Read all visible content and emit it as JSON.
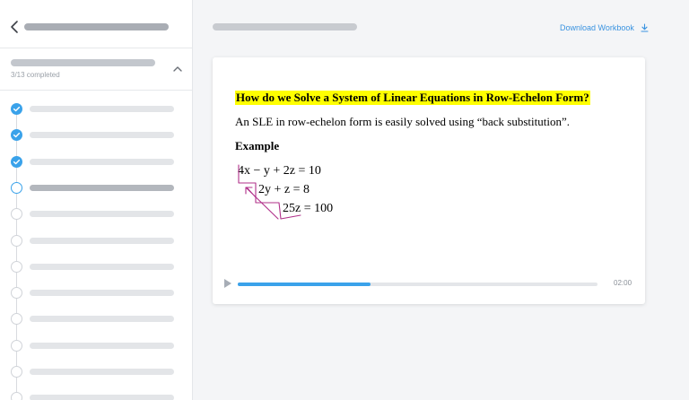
{
  "sidebar": {
    "progress_text": "3/13 completed",
    "lessons": [
      {
        "status": "done"
      },
      {
        "status": "done"
      },
      {
        "status": "done"
      },
      {
        "status": "current"
      },
      {
        "status": "todo"
      },
      {
        "status": "todo"
      },
      {
        "status": "todo"
      },
      {
        "status": "todo"
      },
      {
        "status": "todo"
      },
      {
        "status": "todo"
      },
      {
        "status": "todo"
      },
      {
        "status": "todo"
      }
    ]
  },
  "header": {
    "download_label": "Download Workbook"
  },
  "slide": {
    "title": "How do we Solve a System of Linear Equations in Row-Echelon Form?",
    "body": "An SLE in row-echelon form is easily solved using “back substitution”.",
    "example_heading": "Example",
    "equations": [
      "4x − y + 2z = 10",
      "2y + z = 8",
      "25z = 100"
    ]
  },
  "player": {
    "time": "02:00",
    "progress": 0.37
  },
  "colors": {
    "accent": "#3aa2ea",
    "highlight": "#ffff00",
    "annotation": "#b0308a"
  }
}
